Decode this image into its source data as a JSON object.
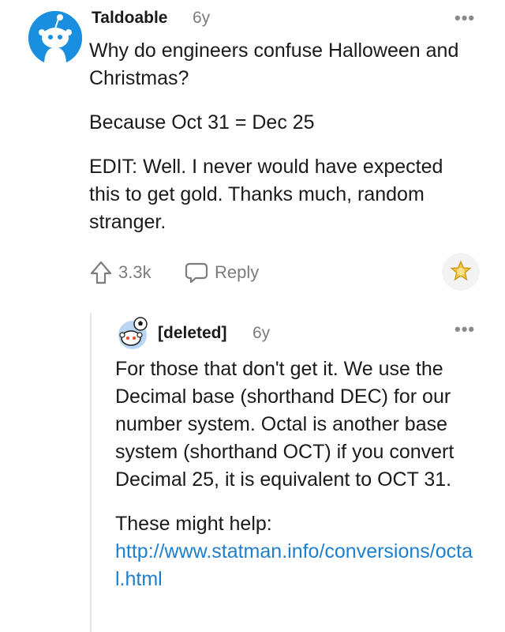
{
  "comment": {
    "username": "Taldoable",
    "age": "6y",
    "more": "•••",
    "paragraphs": [
      "Why do engineers confuse Halloween and Christmas?",
      "Because Oct 31 = Dec 25",
      "EDIT: Well. I never would have expected this to get gold. Thanks much, random stranger."
    ],
    "upvote_count": "3.3k",
    "reply_label": "Reply",
    "award_icon": "gold-award-icon"
  },
  "reply": {
    "username": "[deleted]",
    "age": "6y",
    "more": "•••",
    "paragraphs": [
      "For those that don't get it. We use the Decimal base (shorthand DEC) for our number system. Octal is another base system (shorthand OCT) if you convert Decimal 25, it is equivalent to OCT 31.",
      "These might help:"
    ],
    "link_text": "http://www.statman.info/conversions/octal.html"
  },
  "colors": {
    "link": "#1f7fcf",
    "avatar_blue": "#1a8fe0",
    "award_gold": "#f2c43a",
    "meta_gray": "#7c7c7c"
  }
}
